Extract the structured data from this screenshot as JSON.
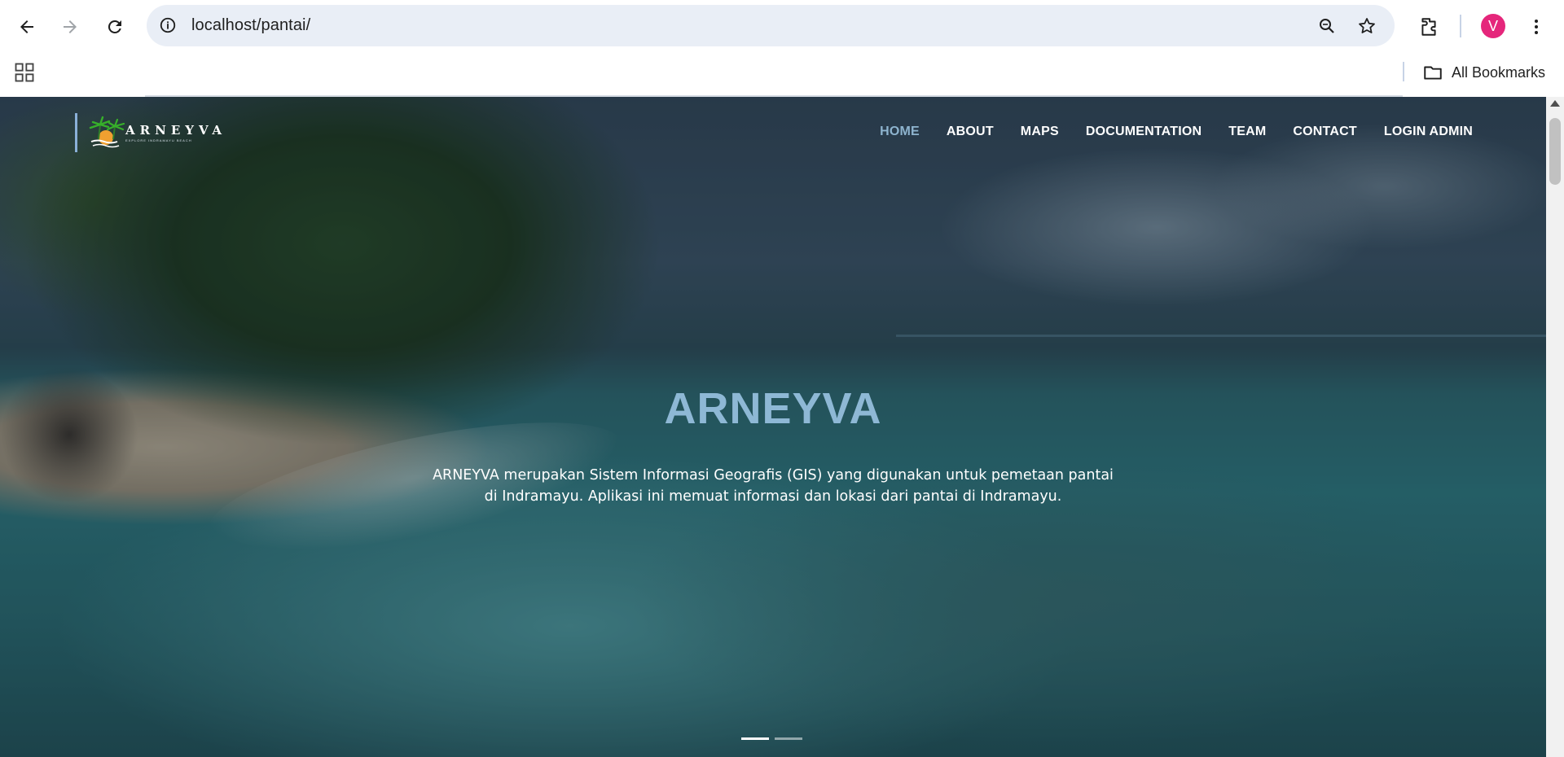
{
  "browser": {
    "url_host": "localhost",
    "url_path": "/pantai/",
    "profile_initial": "V",
    "bookmarks_label": "All Bookmarks",
    "icons": [
      "back-icon",
      "forward-icon",
      "reload-icon",
      "info-icon",
      "zoom-icon",
      "star-icon",
      "extensions-icon",
      "menu-dots-icon",
      "apps-grid-icon",
      "folder-icon"
    ]
  },
  "site": {
    "logo": {
      "brand": "ARNEYVA",
      "tagline": "EXPLORE INDRAMAYU BEACH"
    },
    "nav": [
      {
        "label": "HOME",
        "active": true
      },
      {
        "label": "ABOUT",
        "active": false
      },
      {
        "label": "MAPS",
        "active": false
      },
      {
        "label": "DOCUMENTATION",
        "active": false
      },
      {
        "label": "TEAM",
        "active": false
      },
      {
        "label": "CONTACT",
        "active": false
      },
      {
        "label": "LOGIN ADMIN",
        "active": false
      }
    ],
    "hero": {
      "title": "ARNEYVA",
      "description": "ARNEYVA merupakan Sistem Informasi Geografis (GIS) yang digunakan untuk pemetaan pantai di Indramayu. Aplikasi ini memuat informasi dan lokasi dari pantai di Indramayu."
    },
    "carousel": {
      "slides": 2,
      "active_index": 0
    }
  },
  "colors": {
    "nav_active": "#8eb4cf",
    "hero_title": "#8eb8d5",
    "avatar_bg": "#e5267b",
    "omnibox_bg": "#e9eef6"
  }
}
